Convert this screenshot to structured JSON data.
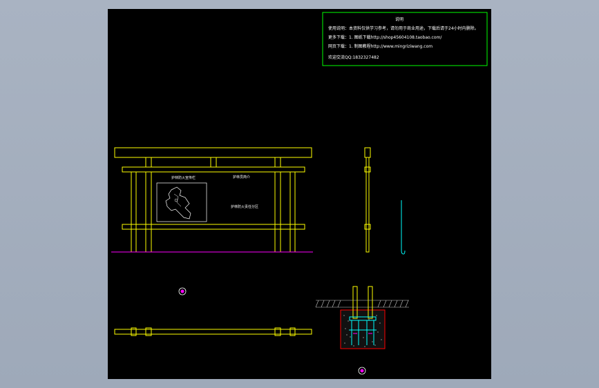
{
  "viewport": {
    "background": "#000000",
    "workspace_background": "#a9b3c2"
  },
  "colors": {
    "frame": "#ffff00",
    "ground_line": "#ff00ff",
    "note_border": "#00ff00",
    "anchor": "#00ffff",
    "foundation_border": "#ff0000",
    "marker": "#ff00ff"
  },
  "note_box": {
    "title": "说明",
    "lines": [
      "使用说明：本资料仅供学习参考，请勿用于商业用途，下载后请于24小时内删除。",
      "更多下载：1. 图纸下载http://shop45604108.taobao.com/",
      "网页下载：1. 制图教程http://www.mingriziwang.com",
      "欢迎交流QQ:1832327482"
    ]
  },
  "signboard": {
    "title_left": "护林防火宣传栏",
    "title_right": "护林员简介",
    "label_bottom": "护林防火责任分区"
  },
  "icons": {
    "marker_a": "circle-marker-icon",
    "marker_b": "circle-marker-icon",
    "map": "forest-area-map-icon"
  }
}
